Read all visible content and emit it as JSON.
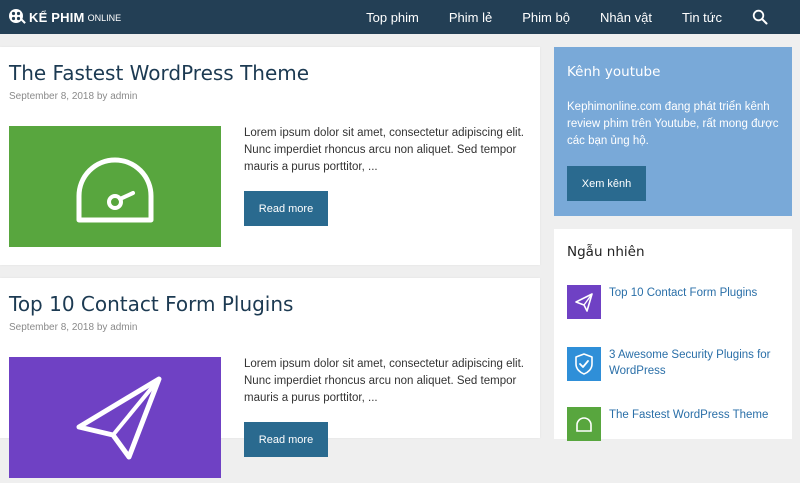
{
  "site": {
    "logo_text": "KỂ PHIM",
    "logo_sub": "ONLINE"
  },
  "nav": {
    "items": [
      "Top phim",
      "Phim lẻ",
      "Phim bộ",
      "Nhân vật",
      "Tin tức"
    ]
  },
  "posts": [
    {
      "title": "The Fastest WordPress Theme",
      "date": "September 8, 2018",
      "by": "by",
      "author": "admin",
      "excerpt": "Lorem ipsum dolor sit amet, consectetur adipiscing elit. Nunc imperdiet rhoncus arcu non aliquet. Sed tempor mauris a purus porttitor, ...",
      "read_more": "Read more",
      "thumb_color": "#58a63e",
      "thumb_icon": "gauge-icon"
    },
    {
      "title": "Top 10 Contact Form Plugins",
      "date": "September 8, 2018",
      "by": "by",
      "author": "admin",
      "excerpt": "Lorem ipsum dolor sit amet, consectetur adipiscing elit. Nunc imperdiet rhoncus arcu non aliquet. Sed tempor mauris a purus porttitor, ...",
      "read_more": "Read more",
      "thumb_color": "#6f41c4",
      "thumb_icon": "paper-plane-icon"
    }
  ],
  "sidebar": {
    "youtube": {
      "title": "Kênh youtube",
      "text": "Kephimonline.com đang phát triển kênh review phim trên Youtube, rất mong được các bạn ủng hộ.",
      "button": "Xem kênh",
      "bg_color": "#79a9d8"
    },
    "random": {
      "title": "Ngẫu nhiên",
      "items": [
        {
          "label": "Top 10 Contact Form Plugins",
          "color": "#6f41c4",
          "icon": "paper-plane-icon"
        },
        {
          "label": "3 Awesome Security Plugins for WordPress",
          "color": "#2f8fd8",
          "icon": "shield-check-icon"
        },
        {
          "label": "The Fastest WordPress Theme",
          "color": "#58a63e",
          "icon": "gauge-icon"
        }
      ]
    }
  },
  "colors": {
    "header_bg": "#233f55",
    "button_bg": "#2a6a8f",
    "link": "#2a6fa8",
    "title": "#1c3a52"
  }
}
